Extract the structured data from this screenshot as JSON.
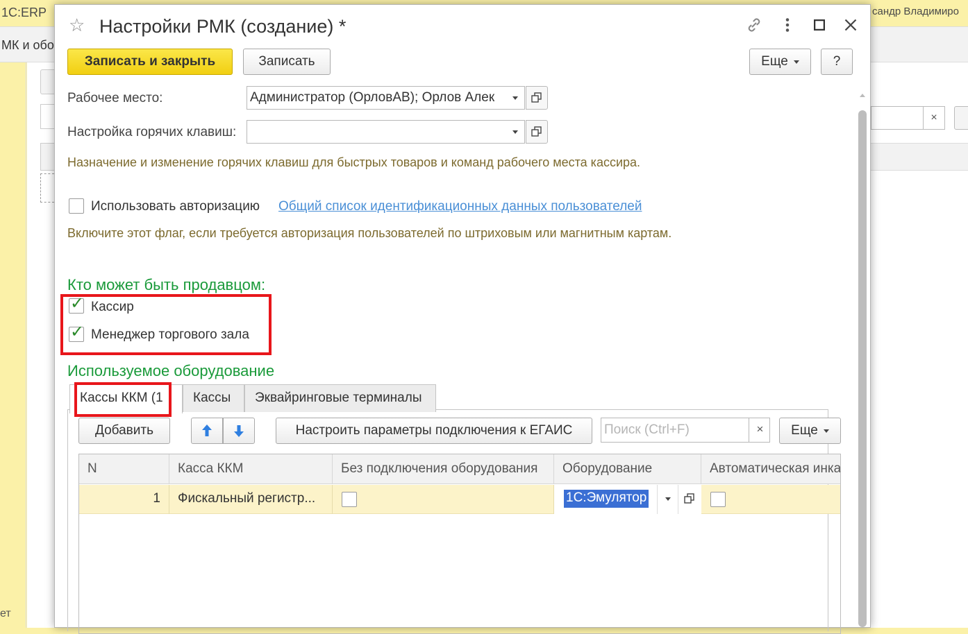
{
  "background": {
    "app_title": "1С:ERP",
    "user_name": "сандр Владимиро",
    "open_tab": "МК и обо",
    "left_text": "ет",
    "search_clear": "×"
  },
  "window": {
    "title": "Настройки РМК (создание) *",
    "toolbar": {
      "save_close": "Записать и закрыть",
      "save": "Записать",
      "more": "Еще",
      "help": "?"
    }
  },
  "form": {
    "workplace_label": "Рабочее место:",
    "workplace_value": "Администратор (ОрловАВ); Орлов Алек",
    "hotkeys_label": "Настройка горячих клавиш:",
    "hotkeys_value": "",
    "hotkeys_hint": "Назначение и изменение горячих клавиш для быстрых товаров и команд рабочего места кассира.",
    "use_auth_label": "Использовать авторизацию",
    "use_auth_checked": false,
    "auth_link": "Общий список идентификационных данных пользователей",
    "auth_hint": "Включите этот флаг, если требуется авторизация пользователей по штриховым или магнитным картам.",
    "seller_title": "Кто может быть продавцом:",
    "cashier_label": "Кассир",
    "cashier_checked": true,
    "manager_label": "Менеджер торгового зала",
    "manager_checked": true,
    "equipment_title": "Используемое оборудование"
  },
  "tabs": [
    {
      "label": "Кассы ККМ (1",
      "active": true
    },
    {
      "label": "Кассы",
      "active": false
    },
    {
      "label": "Эквайринговые терминалы",
      "active": false
    }
  ],
  "table_toolbar": {
    "add": "Добавить",
    "egais": "Настроить параметры подключения к ЕГАИС",
    "search_placeholder": "Поиск (Ctrl+F)",
    "search_clear": "×",
    "more": "Еще"
  },
  "table": {
    "columns": [
      "N",
      "Касса ККМ",
      "Без подключения оборудования",
      "Оборудование",
      "Автоматическая инка"
    ],
    "rows": [
      {
        "n": "1",
        "kassa": "Фискальный регистр...",
        "no_equipment": false,
        "equipment": "1С:Эмулятор",
        "auto": false
      }
    ]
  },
  "colors": {
    "primary_button": "#f1cf12",
    "section_title": "#1a9a3a",
    "highlight": "#e8161b",
    "link": "#4a8fd6",
    "selected_row": "#fcf3c9"
  }
}
